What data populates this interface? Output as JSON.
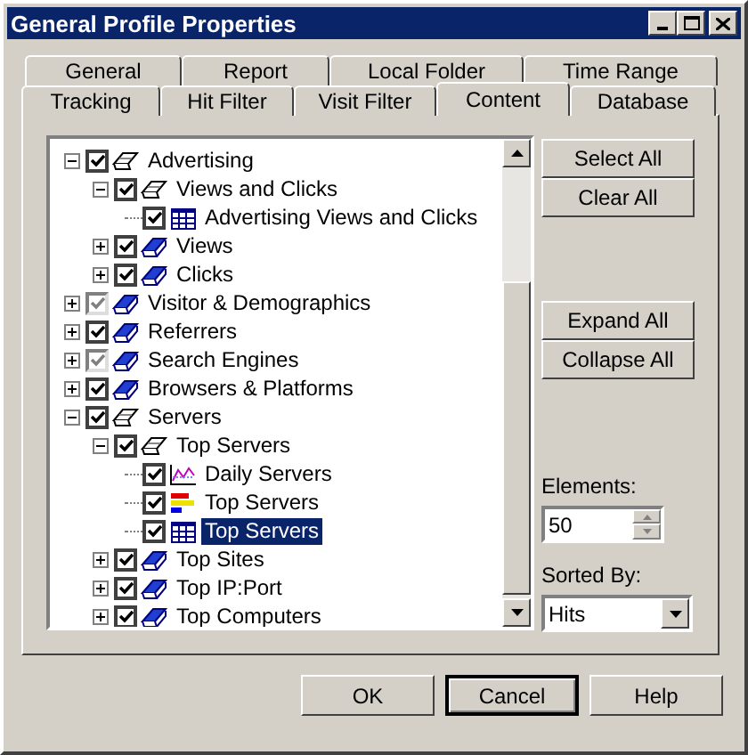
{
  "window": {
    "title": "General Profile Properties"
  },
  "tab_rows": [
    [
      {
        "label": "General",
        "selected": false
      },
      {
        "label": "Report",
        "selected": false
      },
      {
        "label": "Local Folder",
        "selected": false
      },
      {
        "label": "Time Range",
        "selected": false
      }
    ],
    [
      {
        "label": "Tracking",
        "selected": false
      },
      {
        "label": "Hit Filter",
        "selected": false
      },
      {
        "label": "Visit Filter",
        "selected": false
      },
      {
        "label": "Content",
        "selected": true
      },
      {
        "label": "Database",
        "selected": false
      }
    ]
  ],
  "tree": [
    {
      "label": "Advertising",
      "kind": "open-book",
      "checked": true,
      "disabled": false,
      "expanded": true,
      "selected": false,
      "children": [
        {
          "label": "Views and Clicks",
          "kind": "open-book",
          "checked": true,
          "disabled": false,
          "expanded": true,
          "selected": false,
          "children": [
            {
              "label": "Advertising Views and Clicks",
              "kind": "table",
              "checked": true,
              "disabled": false,
              "selected": false
            }
          ]
        },
        {
          "label": "Views",
          "kind": "book",
          "checked": true,
          "disabled": false,
          "expanded": false,
          "selected": false
        },
        {
          "label": "Clicks",
          "kind": "book",
          "checked": true,
          "disabled": false,
          "expanded": false,
          "selected": false
        }
      ]
    },
    {
      "label": "Visitor & Demographics",
      "kind": "book",
      "checked": true,
      "disabled": true,
      "expanded": false,
      "selected": false
    },
    {
      "label": "Referrers",
      "kind": "book",
      "checked": true,
      "disabled": false,
      "expanded": false,
      "selected": false
    },
    {
      "label": "Search Engines",
      "kind": "book",
      "checked": true,
      "disabled": true,
      "expanded": false,
      "selected": false
    },
    {
      "label": "Browsers & Platforms",
      "kind": "book",
      "checked": true,
      "disabled": false,
      "expanded": false,
      "selected": false
    },
    {
      "label": "Servers",
      "kind": "open-book",
      "checked": true,
      "disabled": false,
      "expanded": true,
      "selected": false,
      "children": [
        {
          "label": "Top Servers",
          "kind": "open-book",
          "checked": true,
          "disabled": false,
          "expanded": true,
          "selected": false,
          "children": [
            {
              "label": "Daily Servers",
              "kind": "line-chart",
              "checked": true,
              "disabled": false,
              "selected": false
            },
            {
              "label": "Top Servers",
              "kind": "bar-chart",
              "checked": true,
              "disabled": false,
              "selected": false
            },
            {
              "label": "Top Servers",
              "kind": "table",
              "checked": true,
              "disabled": false,
              "selected": true
            }
          ]
        },
        {
          "label": "Top Sites",
          "kind": "book",
          "checked": true,
          "disabled": false,
          "expanded": false,
          "selected": false
        },
        {
          "label": "Top IP:Port",
          "kind": "book",
          "checked": true,
          "disabled": false,
          "expanded": false,
          "selected": false
        },
        {
          "label": "Top Computers",
          "kind": "book",
          "checked": true,
          "disabled": false,
          "expanded": false,
          "selected": false
        }
      ]
    }
  ],
  "tree_buttons": [
    {
      "label": "Select All"
    },
    {
      "label": "Clear All"
    }
  ],
  "expand_buttons": [
    {
      "label": "Expand All"
    },
    {
      "label": "Collapse All"
    }
  ],
  "elements": {
    "label": "Elements:",
    "value": "50"
  },
  "sorted_by": {
    "label": "Sorted By:",
    "value": "Hits"
  },
  "buttons": [
    {
      "label": "OK",
      "default": false
    },
    {
      "label": "Cancel",
      "default": true
    },
    {
      "label": "Help",
      "default": false
    }
  ]
}
